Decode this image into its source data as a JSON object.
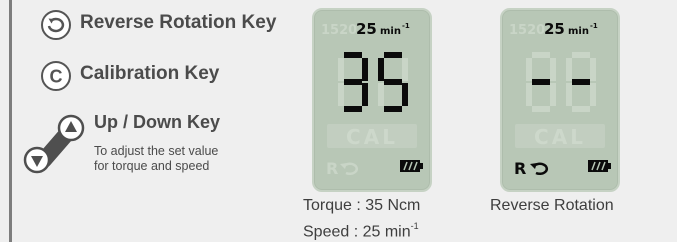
{
  "keys": {
    "reverse": {
      "label": "Reverse Rotation Key",
      "icon": "reverse-rotation-icon"
    },
    "calibration": {
      "label": "Calibration Key",
      "icon": "calibration-icon",
      "glyph": "C"
    },
    "updown": {
      "label": "Up / Down Key",
      "icon": "up-down-key-icon",
      "desc_line1": "To adjust the set value",
      "desc_line2": "for torque and speed"
    }
  },
  "display_left": {
    "dim_speed": "1520",
    "speed_value": "25",
    "speed_unit": "min",
    "speed_exp": "-1",
    "torque_digits": "35",
    "cal_text": "CAL",
    "r_label": "R",
    "reverse_active": false
  },
  "display_right": {
    "dim_speed": "1520",
    "speed_value": "25",
    "speed_unit": "min",
    "speed_exp": "-1",
    "torque_digits": "--",
    "cal_text": "CAL",
    "r_label": "R",
    "reverse_active": true
  },
  "captions": {
    "left_line1": "Torque : 35 Ncm",
    "left_line2": "Speed : 25 min",
    "left_line2_exp": "-1",
    "right_line1": "Reverse Rotation"
  },
  "colors": {
    "lcd_bg": "#b8c7b6",
    "lcd_segment_on": "#0b0b0b",
    "lcd_segment_off": "#c9d5c7",
    "text": "#4b4b4b"
  }
}
